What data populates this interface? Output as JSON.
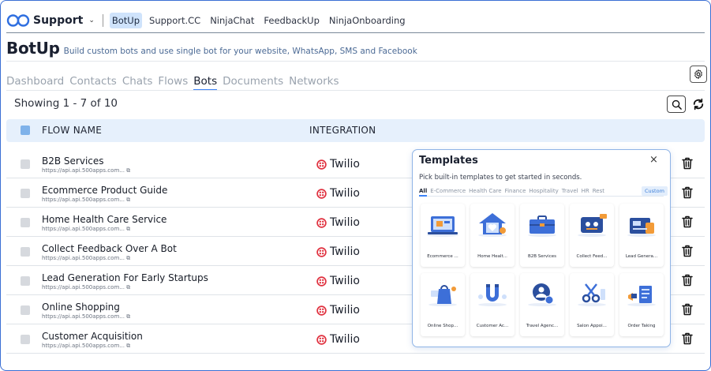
{
  "header": {
    "brand": "Support",
    "nav": [
      "BotUp",
      "Support.CC",
      "NinjaChat",
      "FeedbackUp",
      "NinjaOnboarding"
    ],
    "active_nav": "BotUp"
  },
  "page": {
    "title": "BotUp",
    "subtitle": "Build custom bots and use single bot for your website, WhatsApp, SMS and Facebook"
  },
  "tabs": [
    "Dashboard",
    "Contacts",
    "Chats",
    "Flows",
    "Bots",
    "Documents",
    "Networks"
  ],
  "active_tab": "Bots",
  "list": {
    "showing": "Showing 1 - 7 of 10",
    "columns": [
      "FLOW NAME",
      "INTEGRATION"
    ],
    "rows": [
      {
        "name": "B2B Services",
        "url": "https://api.api.500apps.com...",
        "integration": "Twilio"
      },
      {
        "name": "Ecommerce Product Guide",
        "url": "https://api.api.500apps.com...",
        "integration": "Twilio"
      },
      {
        "name": "Home Health Care Service",
        "url": "https://api.api.500apps.com...",
        "integration": "Twilio"
      },
      {
        "name": "Collect Feedback Over A Bot",
        "url": "https://api.api.500apps.com...",
        "integration": "Twilio"
      },
      {
        "name": "Lead Generation For Early Startups",
        "url": "https://api.api.500apps.com...",
        "integration": "Twilio"
      },
      {
        "name": "Online Shopping",
        "url": "https://api.api.500apps.com...",
        "integration": "Twilio"
      },
      {
        "name": "Customer Acquisition",
        "url": "https://api.api.500apps.com...",
        "integration": "Twilio"
      }
    ]
  },
  "templates": {
    "title": "Templates",
    "close": "×",
    "description": "Pick built-in templates to get started in seconds.",
    "categories": [
      "All",
      "E-Commerce",
      "Health Care",
      "Finance",
      "Hospitality",
      "Travel",
      "HR",
      "Rest"
    ],
    "active_category": "All",
    "custom_label": "Custom",
    "cards": [
      {
        "label": "Ecommerce ...",
        "icon": "ecommerce-icon"
      },
      {
        "label": "Home Healt...",
        "icon": "home-health-icon"
      },
      {
        "label": "B2B Services",
        "icon": "briefcase-icon"
      },
      {
        "label": "Collect Feed...",
        "icon": "feedback-icon"
      },
      {
        "label": "Lead Genera...",
        "icon": "lead-icon"
      },
      {
        "label": "Online Shop...",
        "icon": "shopping-bag-icon"
      },
      {
        "label": "Customer Ac...",
        "icon": "magnet-icon"
      },
      {
        "label": "Travel Agenc...",
        "icon": "travel-icon"
      },
      {
        "label": "Salon Appoi...",
        "icon": "scissors-icon"
      },
      {
        "label": "Order Taking",
        "icon": "order-icon"
      }
    ]
  },
  "colors": {
    "accent": "#3b82f6",
    "twilio": "#e0313f",
    "header_bg": "#e6f0fc",
    "subtitle": "#4b6a95"
  }
}
